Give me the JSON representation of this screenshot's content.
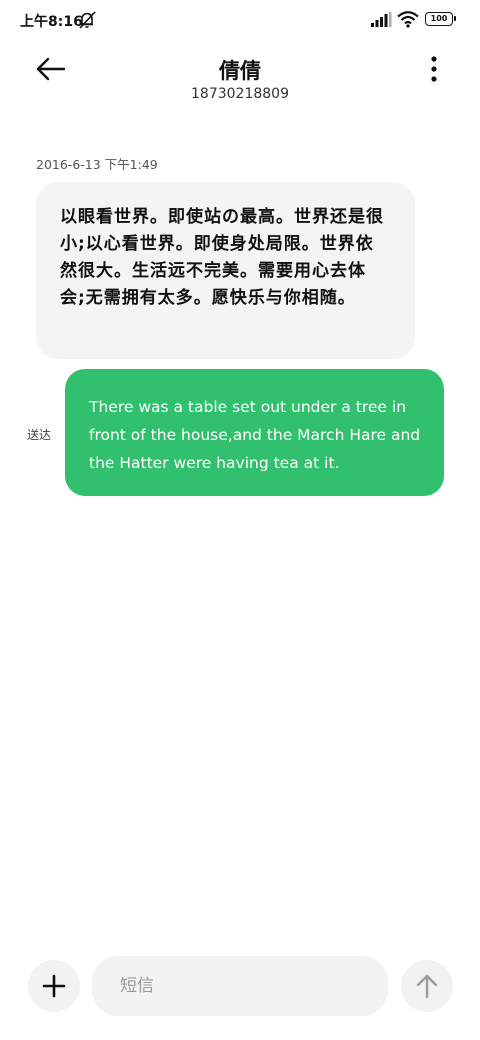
{
  "status_bar": {
    "time": "上午8:16",
    "battery_level": "100",
    "icons": [
      "mute-icon",
      "signal-icon",
      "wifi-icon",
      "battery-icon"
    ]
  },
  "header": {
    "contact_name": "倩倩",
    "contact_number": "18730218809",
    "icons": [
      "arrow-left-icon",
      "more-vertical-icon"
    ]
  },
  "messages": [
    {
      "direction": "received",
      "timestamp": "2016-6-13  下午1:49",
      "text": "以眼看世界。即使站の最高。世界还是很小;以心看世界。即使身处局限。世界依然很大。生活远不完美。需要用心去体会;无需拥有太多。愿快乐与你相随。"
    },
    {
      "direction": "sent",
      "status": "送达",
      "text": "There was a table set out under a tree in front of the house,and the March Hare and the Hatter were having tea at it."
    }
  ],
  "composer": {
    "placeholder": "短信",
    "value": "",
    "icons": [
      "plus-icon",
      "arrow-up-icon"
    ]
  },
  "colors": {
    "sent_bubble": "#31c06e",
    "received_bubble": "#f4f4f4",
    "background": "#ffffff",
    "input_background": "#f2f2f2"
  }
}
